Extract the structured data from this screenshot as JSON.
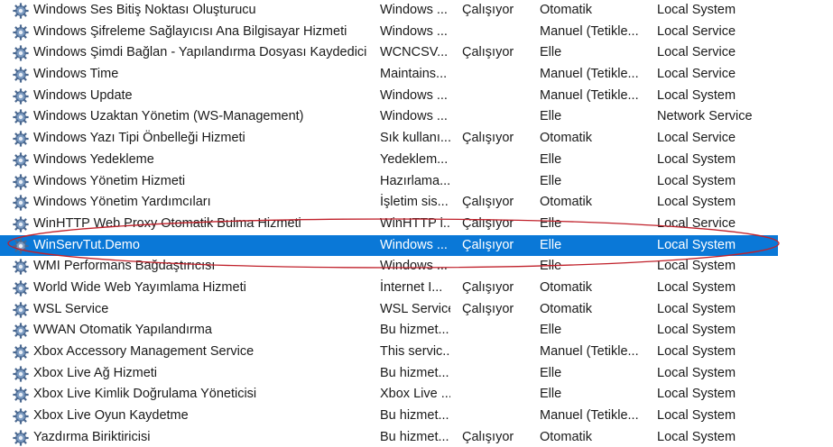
{
  "colors": {
    "selection_bg": "#0a78d7",
    "selection_fg": "#ffffff",
    "annotation": "#c0202a",
    "gear": "#5a7ea8"
  },
  "icons": {
    "service": "gear-icon"
  },
  "services": [
    {
      "name": "Windows Ses Bitiş Noktası Oluşturucu",
      "description": "Windows ...",
      "status": "Çalışıyor",
      "startup": "Otomatik",
      "logon": "Local System"
    },
    {
      "name": "Windows Şifreleme Sağlayıcısı Ana Bilgisayar Hizmeti",
      "description": "Windows ...",
      "status": "",
      "startup": "Manuel (Tetikle...",
      "logon": "Local Service"
    },
    {
      "name": "Windows Şimdi Bağlan - Yapılandırma Dosyası Kaydedici",
      "description": "WCNCSV...",
      "status": "Çalışıyor",
      "startup": "Elle",
      "logon": "Local Service"
    },
    {
      "name": "Windows Time",
      "description": "Maintains...",
      "status": "",
      "startup": "Manuel (Tetikle...",
      "logon": "Local Service"
    },
    {
      "name": "Windows Update",
      "description": "Windows ...",
      "status": "",
      "startup": "Manuel (Tetikle...",
      "logon": "Local System"
    },
    {
      "name": "Windows Uzaktan Yönetim (WS-Management)",
      "description": "Windows ...",
      "status": "",
      "startup": "Elle",
      "logon": "Network Service"
    },
    {
      "name": "Windows Yazı Tipi Önbelleği Hizmeti",
      "description": "Sık kullanı...",
      "status": "Çalışıyor",
      "startup": "Otomatik",
      "logon": "Local Service"
    },
    {
      "name": "Windows Yedekleme",
      "description": "Yedeklem...",
      "status": "",
      "startup": "Elle",
      "logon": "Local System"
    },
    {
      "name": "Windows Yönetim Hizmeti",
      "description": "Hazırlama...",
      "status": "",
      "startup": "Elle",
      "logon": "Local System"
    },
    {
      "name": "Windows Yönetim Yardımcıları",
      "description": "İşletim sis...",
      "status": "Çalışıyor",
      "startup": "Otomatik",
      "logon": "Local System"
    },
    {
      "name": "WinHTTP Web Proxy Otomatik Bulma Hizmeti",
      "description": "WinHTTP i...",
      "status": "Çalışıyor",
      "startup": "Elle",
      "logon": "Local Service"
    },
    {
      "name": "WinServTut.Demo",
      "description": "Windows ...",
      "status": "Çalışıyor",
      "startup": "Elle",
      "logon": "Local System",
      "selected": true
    },
    {
      "name": "WMI Performans Bağdaştırıcısı",
      "description": "Windows ...",
      "status": "",
      "startup": "Elle",
      "logon": "Local System"
    },
    {
      "name": "World Wide Web Yayımlama Hizmeti",
      "description": "İnternet I...",
      "status": "Çalışıyor",
      "startup": "Otomatik",
      "logon": "Local System"
    },
    {
      "name": "WSL Service",
      "description": "WSL Service",
      "status": "Çalışıyor",
      "startup": "Otomatik",
      "logon": "Local System"
    },
    {
      "name": "WWAN Otomatik Yapılandırma",
      "description": "Bu hizmet...",
      "status": "",
      "startup": "Elle",
      "logon": "Local System"
    },
    {
      "name": "Xbox Accessory Management Service",
      "description": "This servic...",
      "status": "",
      "startup": "Manuel (Tetikle...",
      "logon": "Local System"
    },
    {
      "name": "Xbox Live Ağ Hizmeti",
      "description": "Bu hizmet...",
      "status": "",
      "startup": "Elle",
      "logon": "Local System"
    },
    {
      "name": "Xbox Live Kimlik Doğrulama Yöneticisi",
      "description": "Xbox Live ...",
      "status": "",
      "startup": "Elle",
      "logon": "Local System"
    },
    {
      "name": "Xbox Live Oyun Kaydetme",
      "description": "Bu hizmet...",
      "status": "",
      "startup": "Manuel (Tetikle...",
      "logon": "Local System"
    },
    {
      "name": "Yazdırma Biriktiricisi",
      "description": "Bu hizmet...",
      "status": "Çalışıyor",
      "startup": "Otomatik",
      "logon": "Local System"
    }
  ]
}
